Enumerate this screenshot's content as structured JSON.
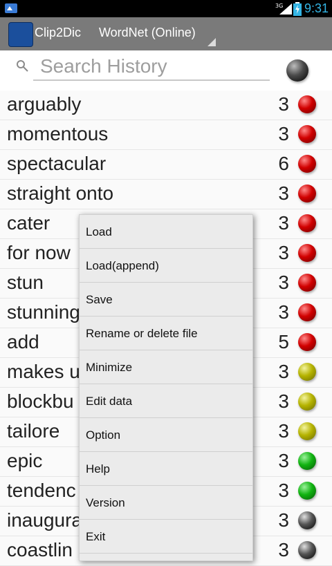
{
  "status_bar": {
    "time": "9:31",
    "network": "3G",
    "left_icon": "app-notification-icon",
    "battery_icon": "battery-icon",
    "signal_icon": "signal-icon"
  },
  "app_bar": {
    "title": "Clip2Dic",
    "dictionary": "WordNet (Online)",
    "icon": "clip2dic-app-icon"
  },
  "search": {
    "placeholder": "Search History",
    "value": ""
  },
  "history": [
    {
      "word": "arguably",
      "count": "3",
      "status": "red"
    },
    {
      "word": "momentous",
      "count": "3",
      "status": "red"
    },
    {
      "word": "spectacular",
      "count": "6",
      "status": "red"
    },
    {
      "word": "straight onto",
      "count": "3",
      "status": "red"
    },
    {
      "word": "cater",
      "count": "3",
      "status": "red"
    },
    {
      "word": "for now",
      "count": "3",
      "status": "red"
    },
    {
      "word": "stun",
      "count": "3",
      "status": "red"
    },
    {
      "word": "stunning",
      "count": "3",
      "status": "red"
    },
    {
      "word": "add",
      "count": "5",
      "status": "red"
    },
    {
      "word": "makes u",
      "count": "3",
      "status": "yellow"
    },
    {
      "word": "blockbu",
      "count": "3",
      "status": "yellow"
    },
    {
      "word": "tailore",
      "count": "3",
      "status": "yellow"
    },
    {
      "word": "epic",
      "count": "3",
      "status": "green"
    },
    {
      "word": "tendenc",
      "count": "3",
      "status": "green"
    },
    {
      "word": "inaugura",
      "count": "3",
      "status": "black"
    },
    {
      "word": "coastlin",
      "count": "3",
      "status": "black"
    }
  ],
  "menu": {
    "items": [
      "Load",
      "Load(append)",
      "Save",
      "Rename or delete file",
      "Minimize",
      "Edit data",
      "Option",
      "Help",
      "Version",
      "Exit"
    ]
  },
  "colors": {
    "status_bar_bg": "#000000",
    "app_bar_bg": "#7a7a7a",
    "clock": "#33b5e5",
    "red": "#d10000",
    "yellow": "#b5b300",
    "green": "#11b311",
    "black": "#000000"
  }
}
